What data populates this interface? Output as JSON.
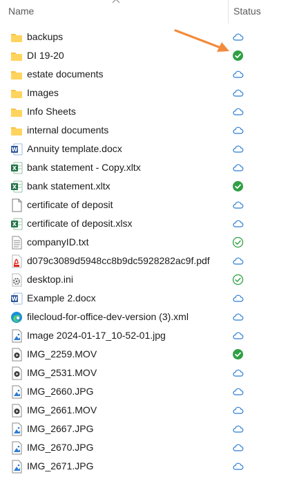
{
  "header": {
    "name_label": "Name",
    "status_label": "Status"
  },
  "colors": {
    "folder": "#f3c342",
    "word": "#2b579a",
    "excel": "#217346",
    "pdf": "#e0261b",
    "cloud": "#2b7cd3",
    "synced": "#2ea043",
    "arrow": "#f28b3c"
  },
  "files": [
    {
      "name": "backups",
      "type": "folder",
      "status": "cloud"
    },
    {
      "name": "DI 19-20",
      "type": "folder",
      "status": "synced"
    },
    {
      "name": "estate documents",
      "type": "folder",
      "status": "cloud"
    },
    {
      "name": "Images",
      "type": "folder",
      "status": "cloud"
    },
    {
      "name": "Info Sheets",
      "type": "folder",
      "status": "cloud"
    },
    {
      "name": "internal documents",
      "type": "folder",
      "status": "cloud"
    },
    {
      "name": "Annuity template.docx",
      "type": "word",
      "status": "cloud"
    },
    {
      "name": "bank statement - Copy.xltx",
      "type": "excel",
      "status": "cloud"
    },
    {
      "name": "bank statement.xltx",
      "type": "excel",
      "status": "synced"
    },
    {
      "name": "certificate of deposit",
      "type": "blank",
      "status": "cloud"
    },
    {
      "name": "certificate of deposit.xlsx",
      "type": "excel",
      "status": "cloud"
    },
    {
      "name": "companyID.txt",
      "type": "text",
      "status": "local"
    },
    {
      "name": "d079c3089d5948cc8b9dc5928282ac9f.pdf",
      "type": "pdf",
      "status": "cloud"
    },
    {
      "name": "desktop.ini",
      "type": "settings",
      "status": "local"
    },
    {
      "name": "Example 2.docx",
      "type": "word",
      "status": "cloud"
    },
    {
      "name": "filecloud-for-office-dev-version (3).xml",
      "type": "edge",
      "status": "cloud"
    },
    {
      "name": "Image 2024-01-17_10-52-01.jpg",
      "type": "image",
      "status": "cloud"
    },
    {
      "name": "IMG_2259.MOV",
      "type": "video",
      "status": "synced"
    },
    {
      "name": "IMG_2531.MOV",
      "type": "video",
      "status": "cloud"
    },
    {
      "name": "IMG_2660.JPG",
      "type": "image",
      "status": "cloud"
    },
    {
      "name": "IMG_2661.MOV",
      "type": "video",
      "status": "cloud"
    },
    {
      "name": "IMG_2667.JPG",
      "type": "image",
      "status": "cloud"
    },
    {
      "name": "IMG_2670.JPG",
      "type": "image",
      "status": "cloud"
    },
    {
      "name": "IMG_2671.JPG",
      "type": "image",
      "status": "cloud"
    }
  ]
}
